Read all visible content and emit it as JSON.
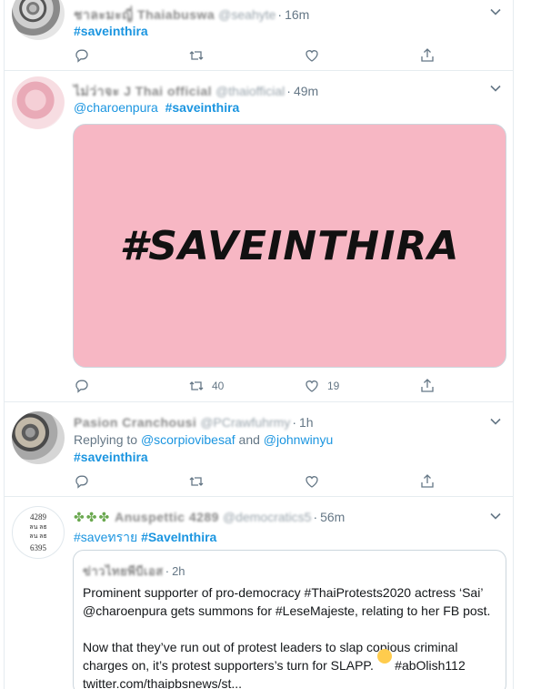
{
  "tweets": [
    {
      "name": "ชาละมะญี่ Thaiabuswa",
      "handle": "@seahyte",
      "time": "16m",
      "body_hashtag": "#saveinthira",
      "actions": {
        "reply": "",
        "retweet": "",
        "like": "",
        "share": ""
      }
    },
    {
      "name": "ไม่ว่าจะ J Thai official",
      "handle": "@thaiofficial",
      "time": "49m",
      "mention": "@charoenpura",
      "hashtag": "#saveinthira",
      "media_text": "#SAVEINTHIRA",
      "actions": {
        "reply": "",
        "retweet": "40",
        "like": "19",
        "share": ""
      }
    },
    {
      "name": "Pasion Cranchousi",
      "handle": "@PCrawfuhrmy",
      "time": "1h",
      "replying_label": "Replying to",
      "reply_user1": "@scorpiovibesaf",
      "reply_and": "and",
      "reply_user2": "@johnwinyu",
      "hashtag": "#saveinthira",
      "actions": {
        "reply": "",
        "retweet": "",
        "like": "",
        "share": ""
      }
    },
    {
      "name": "Anuspettic 4289",
      "handle": "@democratics5",
      "time": "56m",
      "avatar_lines": [
        "4289",
        "ลน ลธ",
        "ลน ลธ",
        "6395"
      ],
      "hashtag1": "#saveทราย",
      "hashtag2": "#SaveInthira",
      "quote": {
        "name": "ข่าวไทยพีบีเอส",
        "time": "2h",
        "para1": "Prominent supporter of pro-democracy #ThaiProtests2020 actress ‘Sai’ @charoenpura gets summons for #LeseMajeste, relating to her FB post.",
        "para2": "Now that they’ve run out of protest leaders to slap copious criminal charges on, it’s protest supporters’s turn for SLAPP.      #abOlish112",
        "para3": "twitter.com/thaipbsnews/st..."
      }
    }
  ],
  "colors": {
    "link": "#1b95e0",
    "muted": "#657786",
    "media_bg": "#f7b7c4",
    "border": "#e6ecf0"
  }
}
